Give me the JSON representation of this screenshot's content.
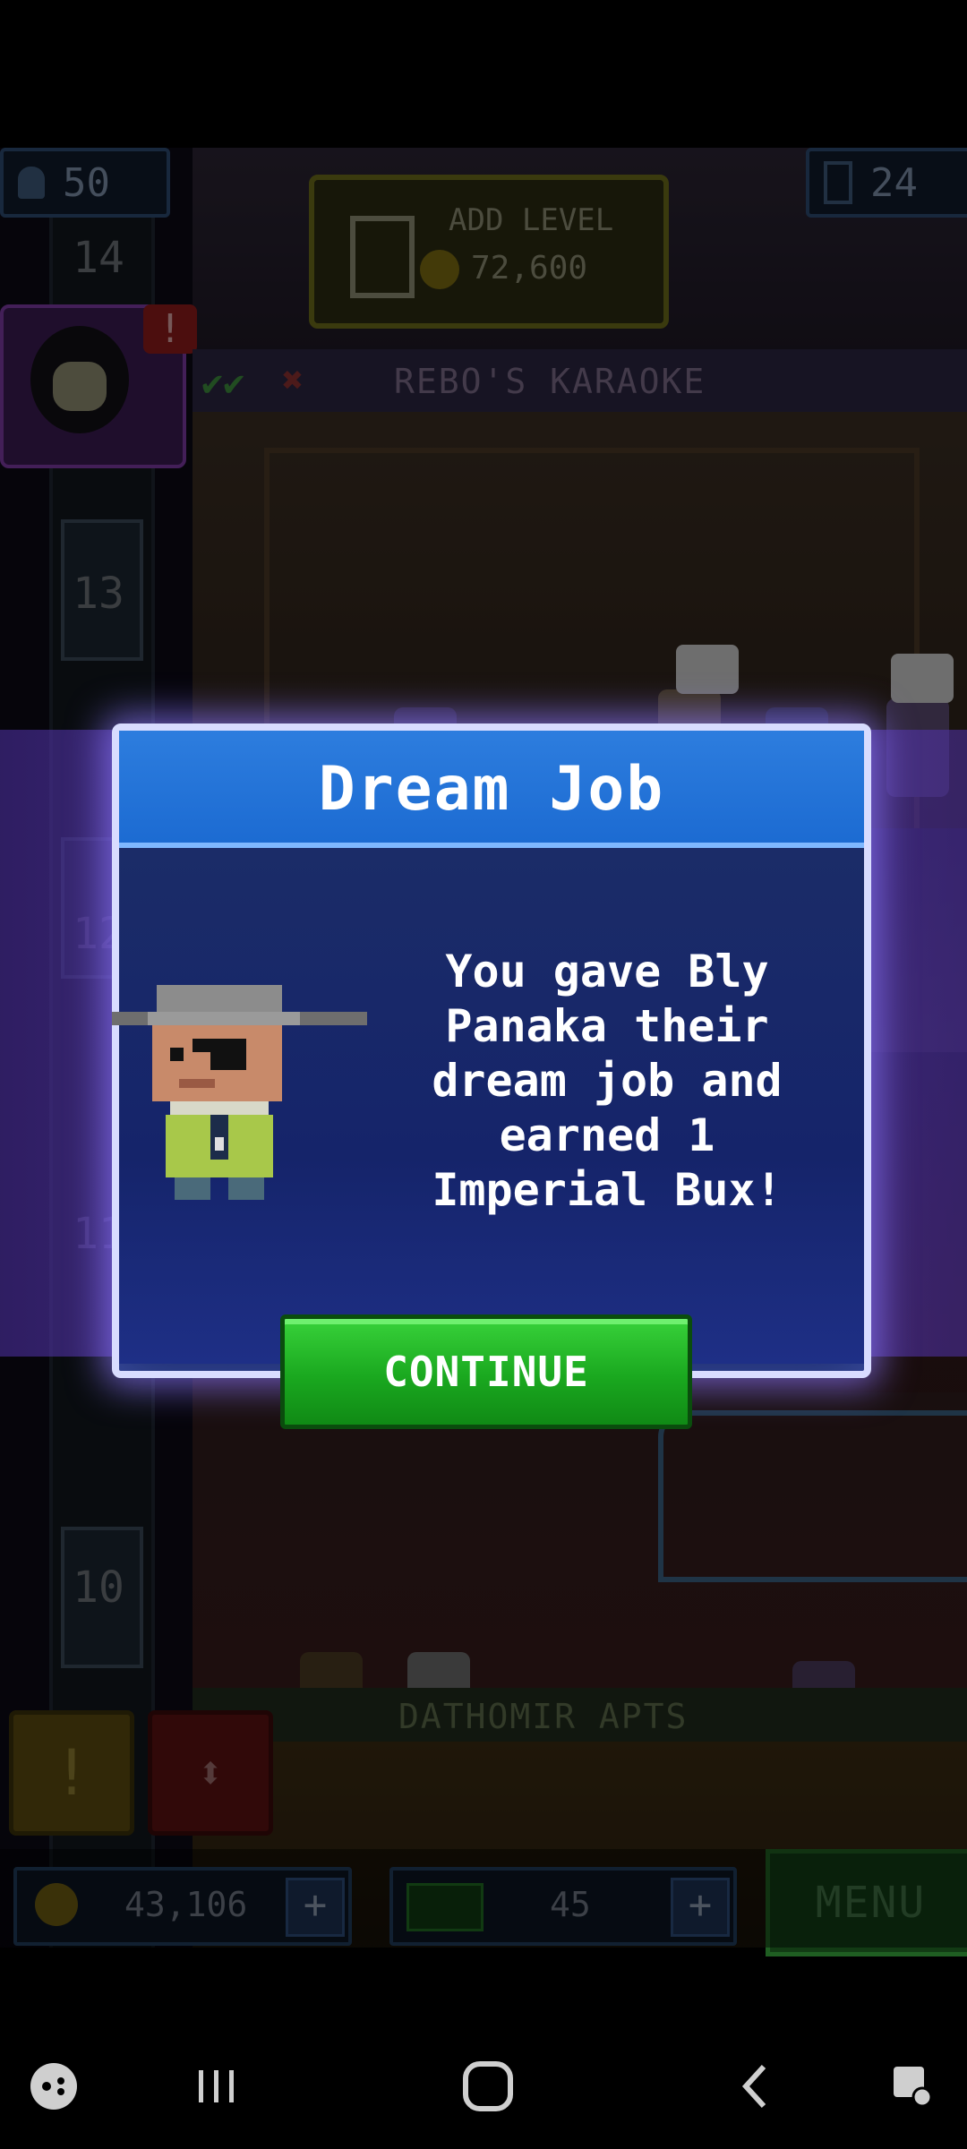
{
  "hud_top": {
    "population": "50",
    "floors": "24"
  },
  "add_level": {
    "label": "ADD LEVEL",
    "cost": "72,600"
  },
  "floors": {
    "f14": "14",
    "f13": "13",
    "f12": "12",
    "f11": "11",
    "f10": "10"
  },
  "rooms": {
    "karaoke": "REBO'S KARAOKE",
    "apartments": "DATHOMIR APTS"
  },
  "modal": {
    "title": "Dream Job",
    "message": "You gave Bly Panaka their dream job and earned 1 Imperial Bux!",
    "continue_label": "CONTINUE"
  },
  "hud_bottom": {
    "coins": "43,106",
    "bux": "45",
    "menu_label": "MENU"
  },
  "colors": {
    "accent_blue": "#1c6bd2",
    "button_green": "#1aa81f",
    "glow_purple": "#6e46d2"
  }
}
